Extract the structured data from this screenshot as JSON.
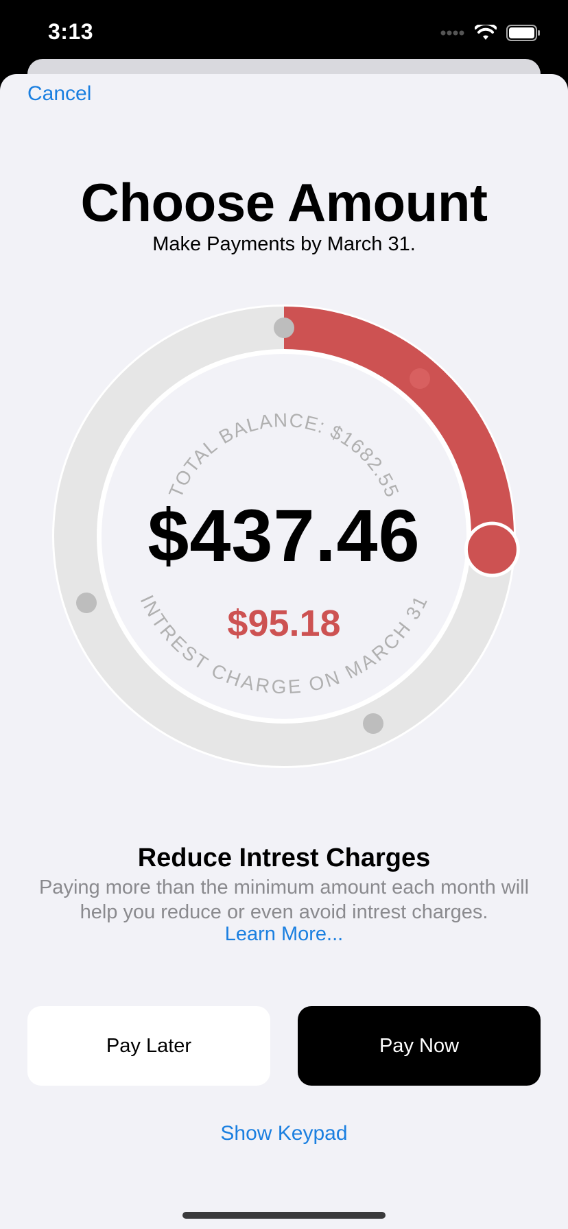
{
  "status_bar": {
    "time": "3:13",
    "icons": [
      "signal-icon",
      "wifi-icon",
      "battery-icon"
    ]
  },
  "nav": {
    "cancel_label": "Cancel"
  },
  "header": {
    "title": "Choose Amount",
    "subtitle": "Make Payments by March 31."
  },
  "dial": {
    "total_balance_label": "TOTAL BALANCE: $1682.55",
    "amount": "$437.46",
    "interest_amount": "$95.18",
    "interest_label": "INTREST CHARGE ON MARCH 31",
    "progress_fraction": 0.26,
    "accent_color": "#cd5252",
    "track_color": "#e6e6e6"
  },
  "info": {
    "title": "Reduce Intrest Charges",
    "body": "Paying more than the minimum amount each month will help you reduce or even avoid intrest charges.",
    "learn_more": "Learn More..."
  },
  "actions": {
    "pay_later": "Pay Later",
    "pay_now": "Pay Now",
    "show_keypad": "Show Keypad"
  }
}
